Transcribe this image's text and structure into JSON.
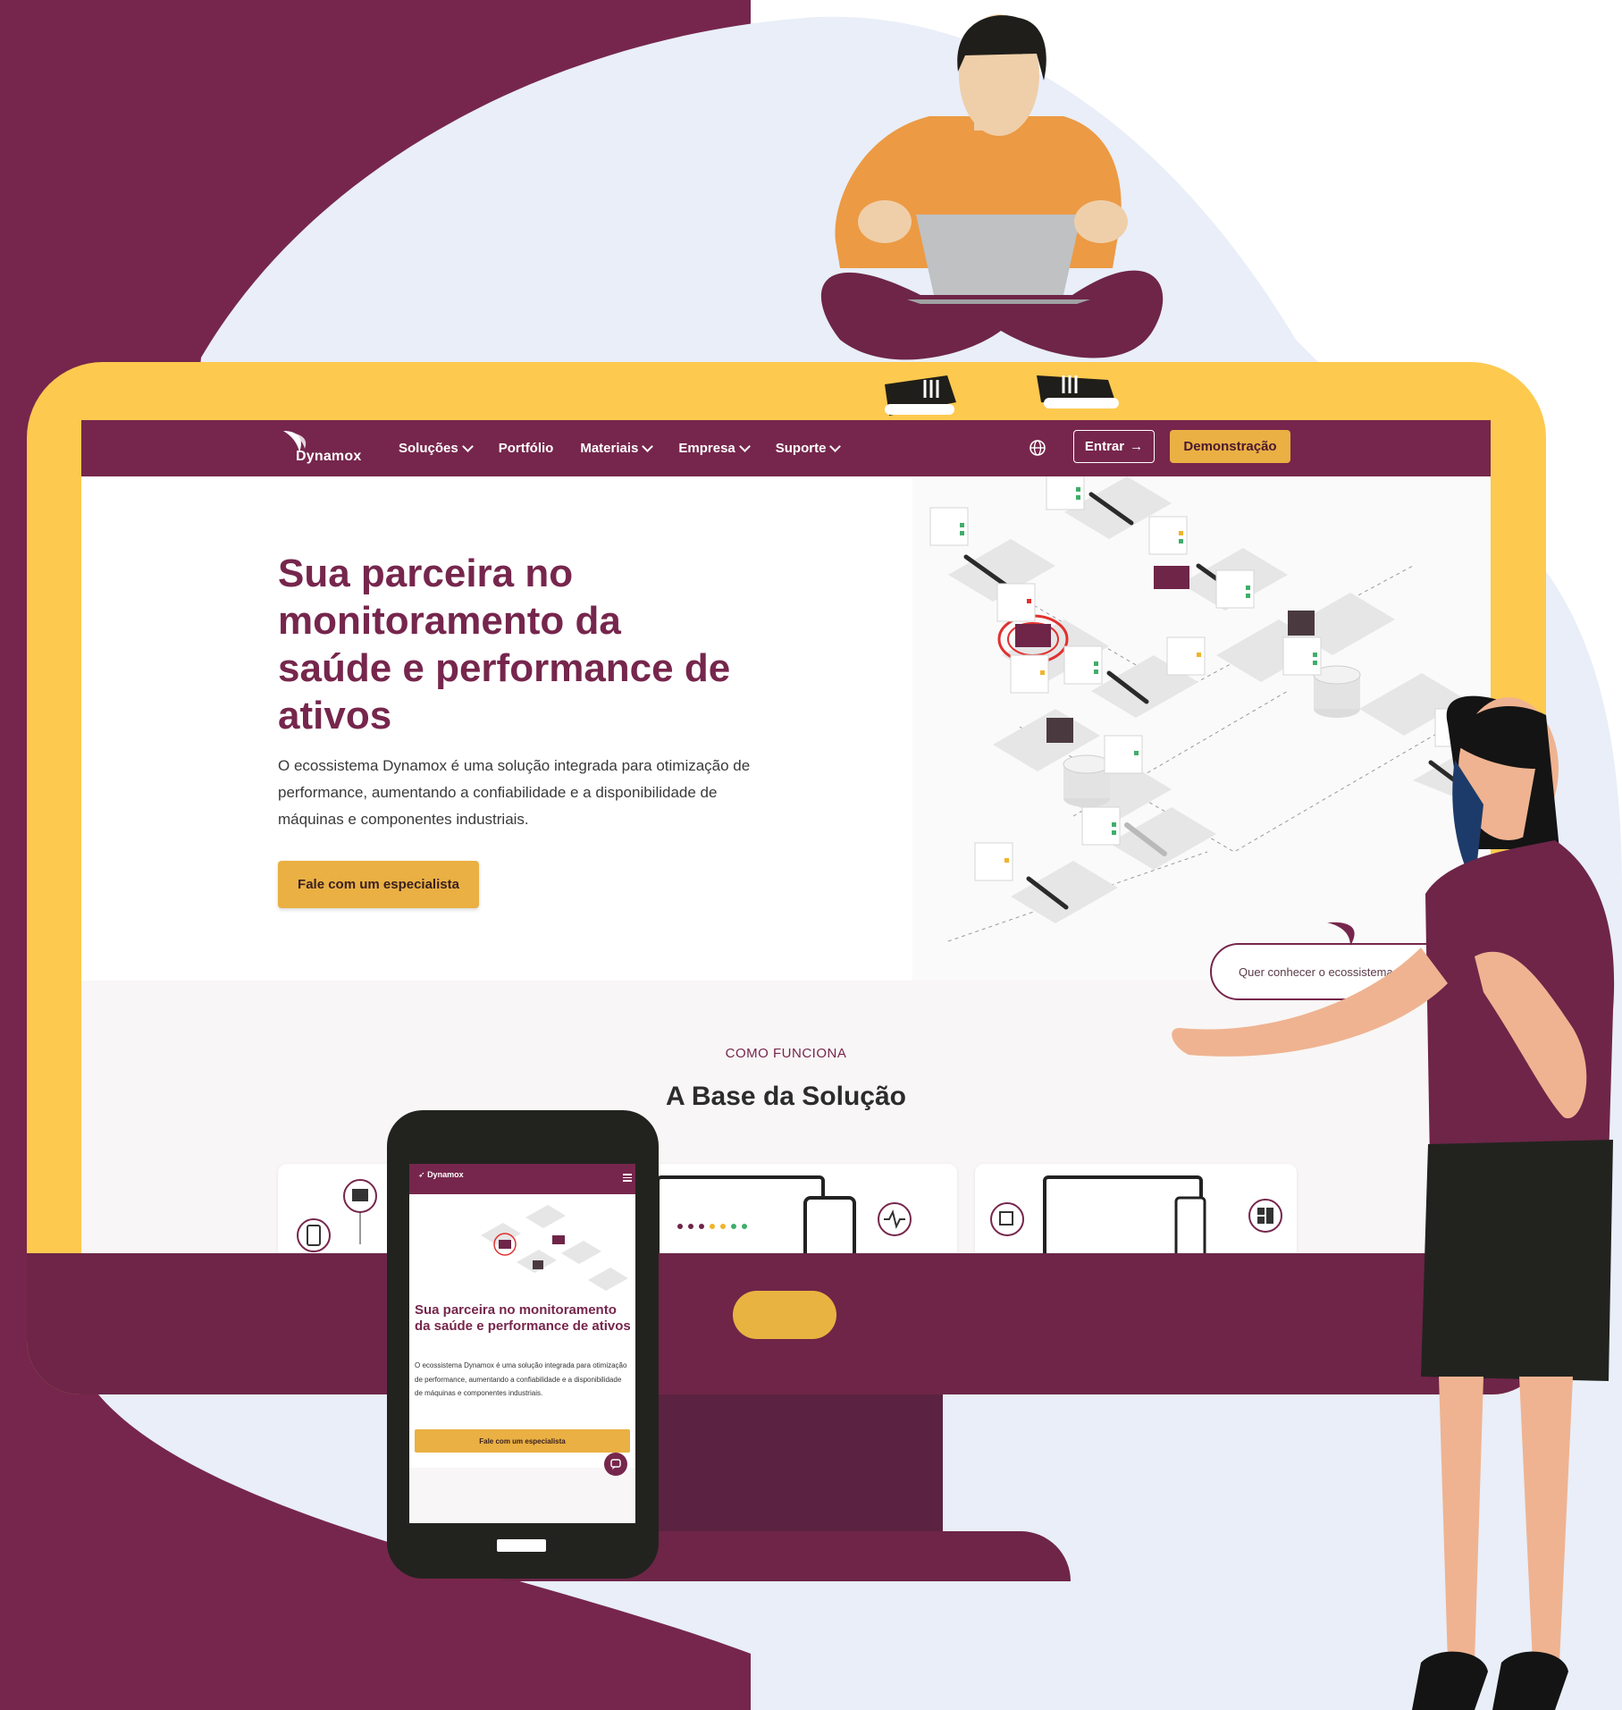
{
  "colors": {
    "brand": "#76264c",
    "accent": "#eab043",
    "monitor": "#fdc94f",
    "background": "#e9eef8"
  },
  "desktop": {
    "nav": {
      "logo": "Dynamox",
      "menu": [
        "Soluções",
        "Portfólio",
        "Materiais",
        "Empresa",
        "Suporte"
      ],
      "login": "Entrar",
      "demo": "Demonstração",
      "icons": {
        "globe": "globe-icon",
        "login_arrow": "arrow-right-icon"
      }
    },
    "hero": {
      "title": "Sua parceira no monitoramento da saúde e performance de ativos",
      "description": "O ecossistema Dynamox é uma solução integrada para otimização de performance, aumentando a confiabilidade e a disponibilidade de máquinas e componentes industriais.",
      "cta": "Fale com um especialista"
    },
    "ecosystem_prompt": "Quer conhecer o ecossistema Dy",
    "section": {
      "eyebrow": "COMO FUNCIONA",
      "title": "A Base da Solução"
    }
  },
  "mobile": {
    "logo": "Dynamox",
    "title": "Sua parceira no monitoramento da saúde e performance de ativos",
    "description": "O ecossistema Dynamox é uma solução integrada para otimização de performance, aumentando a confiabilidade e a disponibilidade de máquinas e componentes industriais.",
    "cta": "Fale com um especialista"
  }
}
